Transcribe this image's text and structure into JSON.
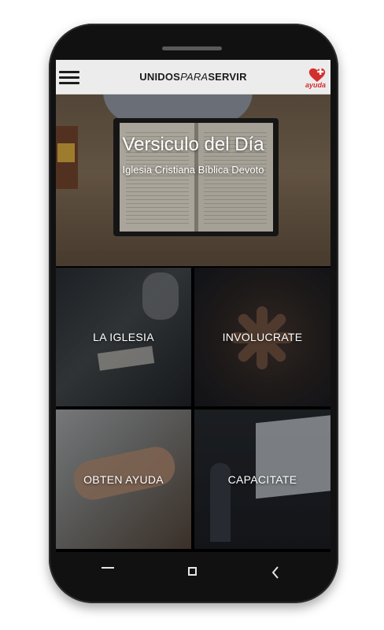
{
  "app_bar": {
    "brand_prefix": "UNIDOS",
    "brand_middle": "PARA",
    "brand_suffix": "SERVIR",
    "help_label": "ayuda",
    "menu_icon": "hamburger-menu-icon",
    "help_icon": "heart-plus-icon"
  },
  "hero": {
    "title": "Versiculo del Día",
    "subtitle": "Iglesia Cristiana Bíblica Devoto"
  },
  "tiles": [
    {
      "label": "LA IGLESIA"
    },
    {
      "label": "INVOLUCRATE"
    },
    {
      "label": "OBTEN AYUDA"
    },
    {
      "label": "CAPACITATE"
    }
  ],
  "nav_bar": {
    "menu_icon": "recent-apps-icon",
    "home_icon": "home-square-icon",
    "back_icon": "back-chevron-icon"
  },
  "colors": {
    "app_bar_bg": "#ececec",
    "help_accent": "#d32f2f",
    "phone_body": "#111111"
  }
}
